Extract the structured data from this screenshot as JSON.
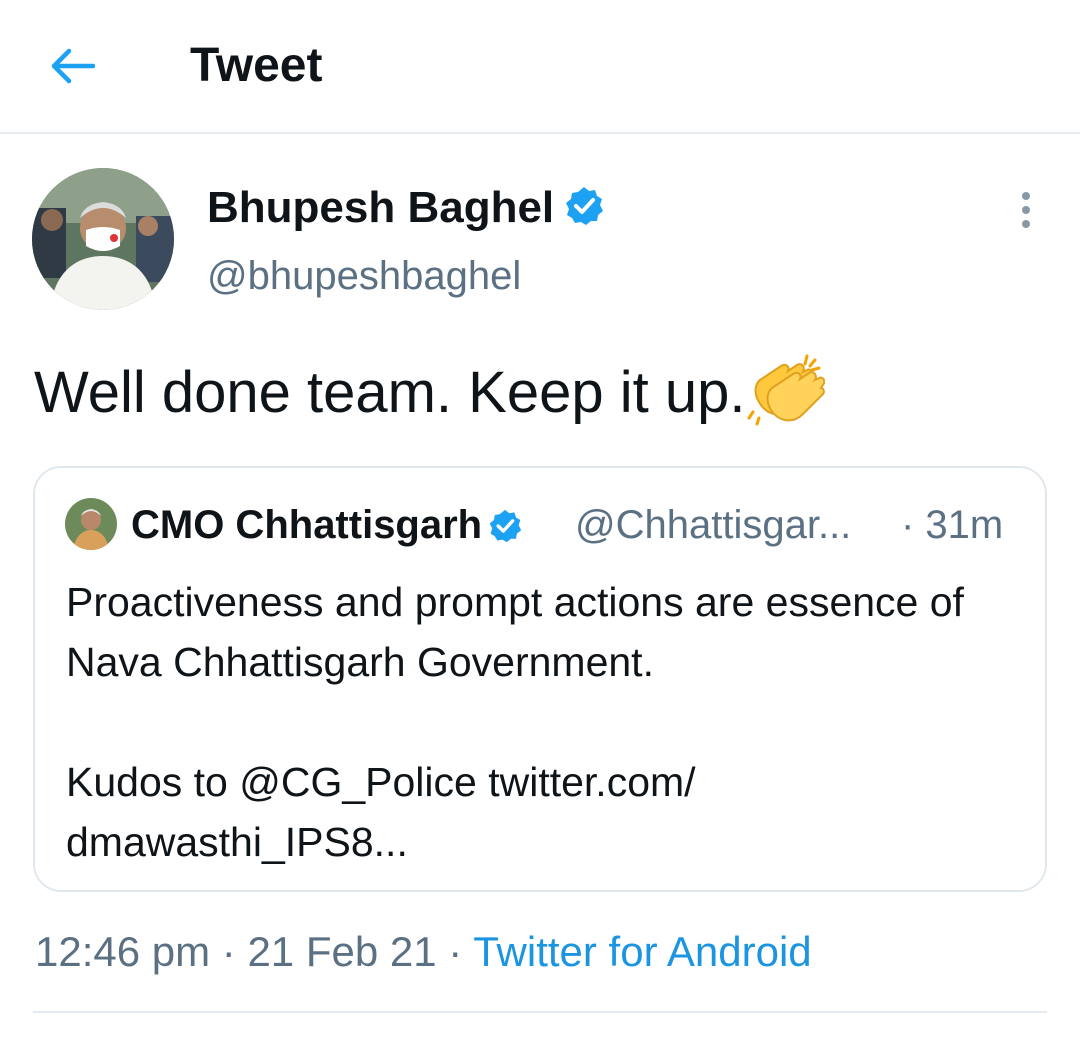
{
  "header": {
    "title": "Tweet",
    "back_icon": "arrow-left-icon",
    "accent": "#1da1f2"
  },
  "tweet": {
    "author": {
      "display_name": "Bhupesh Baghel",
      "handle": "@bhupeshbaghel",
      "verified": true,
      "avatar_icon": "avatar-photo"
    },
    "text": "Well done team. Keep it up.",
    "emoji_icon": "clapping-hands-icon",
    "more_icon": "more-vertical-icon",
    "quoted": {
      "display_name": "CMO Chhattisgarh",
      "handle": "@Chhattisgar...",
      "time": "· 31m",
      "verified": true,
      "paragraph1": "Proactiveness and prompt actions are essence of Nava Chhattisgarh Government.",
      "paragraph2_line1": "Kudos to @CG_Police twitter.com/",
      "paragraph2_line2": "dmawasthi_IPS8..."
    },
    "meta": {
      "time": "12:46 pm",
      "sep1": " · ",
      "date": "21 Feb 21",
      "sep2": " · ",
      "source": "Twitter for Android"
    }
  },
  "colors": {
    "text_primary": "#0f1419",
    "text_secondary": "#5b7083",
    "link": "#1b95e0",
    "verified": "#1da1f2",
    "border": "#e1e8ed"
  }
}
